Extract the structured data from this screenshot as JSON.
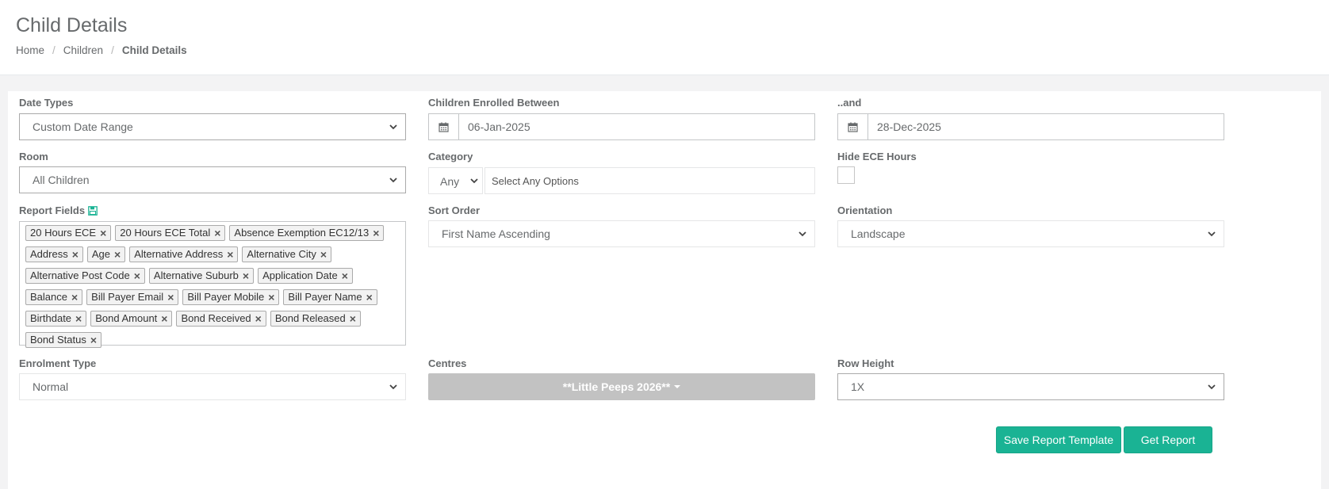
{
  "header": {
    "title": "Child Details",
    "breadcrumb": [
      "Home",
      "Children",
      "Child Details"
    ]
  },
  "form": {
    "date_types": {
      "label": "Date Types",
      "value": "Custom Date Range"
    },
    "enrolled_between": {
      "label": "Children Enrolled Between",
      "value": "06-Jan-2025",
      "icon": "calendar-icon"
    },
    "and": {
      "label": "..and",
      "value": "28-Dec-2025",
      "icon": "calendar-icon"
    },
    "room": {
      "label": "Room",
      "value": "All Children"
    },
    "category": {
      "label": "Category",
      "mode": "Any",
      "placeholder": "Select Any Options"
    },
    "hide_ece": {
      "label": "Hide ECE Hours",
      "checked": false
    },
    "report_fields": {
      "label": "Report Fields",
      "icon": "save-icon",
      "tags": [
        "20 Hours ECE",
        "20 Hours ECE Total",
        "Absence Exemption EC12/13",
        "Address",
        "Age",
        "Alternative Address",
        "Alternative City",
        "Alternative Post Code",
        "Alternative Suburb",
        "Application Date",
        "Balance",
        "Bill Payer Email",
        "Bill Payer Mobile",
        "Bill Payer Name",
        "Birthdate",
        "Bond Amount",
        "Bond Received",
        "Bond Released",
        "Bond Status"
      ],
      "remove_symbol": "×"
    },
    "sort_order": {
      "label": "Sort Order",
      "value": "First Name Ascending"
    },
    "orientation": {
      "label": "Orientation",
      "value": "Landscape"
    },
    "enrolment_type": {
      "label": "Enrolment Type",
      "value": "Normal"
    },
    "centres": {
      "label": "Centres",
      "value": "**Little Peeps 2026**"
    },
    "row_height": {
      "label": "Row Height",
      "value": "1X"
    }
  },
  "actions": {
    "save_template": "Save Report Template",
    "get_report": "Get Report"
  },
  "colors": {
    "primary": "#1ab394",
    "disabled": "#c2c2c2",
    "text": "#676a6c"
  }
}
